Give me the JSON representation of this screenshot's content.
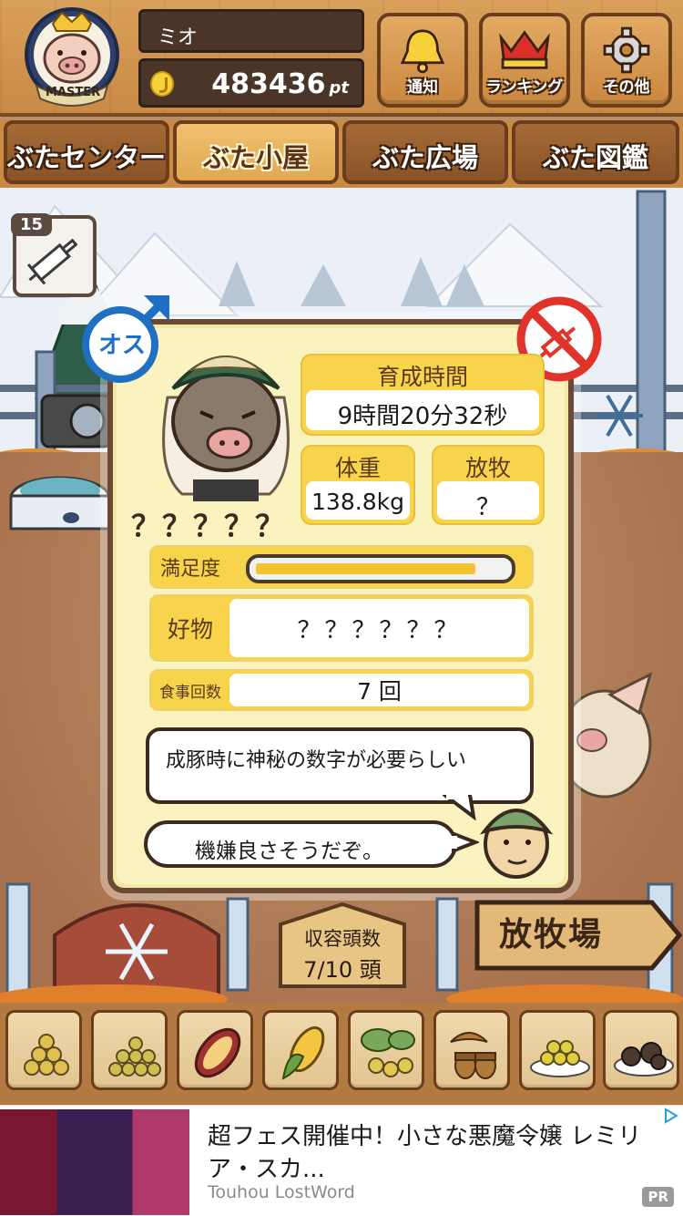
{
  "header": {
    "badge_text": "MASTER",
    "player_name": "ミオ",
    "points": "483436",
    "points_unit": "pt",
    "buttons": [
      {
        "label": "通知",
        "icon": "bell-icon"
      },
      {
        "label": "ランキング",
        "icon": "crown-icon"
      },
      {
        "label": "その他",
        "icon": "gear-icon"
      }
    ]
  },
  "tabs": [
    {
      "label": "ぶたセンター",
      "active": false
    },
    {
      "label": "ぶた小屋",
      "active": true
    },
    {
      "label": "ぶた広場",
      "active": false
    },
    {
      "label": "ぶた図鑑",
      "active": false
    }
  ],
  "vaccine": {
    "count": "15",
    "icon": "syringe-icon"
  },
  "pig": {
    "gender_label": "オス",
    "name": "？？？？？",
    "stats": {
      "growth_label": "育成時間",
      "growth_value": "9時間20分32秒",
      "weight_label": "体重",
      "weight_value": "138.8kg",
      "graze_label": "放牧",
      "graze_value": "？",
      "satisfaction_label": "満足度",
      "satisfaction_level": 0.88,
      "favorite_label": "好物",
      "favorite_value": "？？？？？？",
      "meals_label": "食事回数",
      "meals_value": "7 回"
    }
  },
  "dialogue": {
    "hint": "成豚時に神秘の数字が必要らしい",
    "mood": "機嫌良さそうだぞ。"
  },
  "scene": {
    "sign_label": "放牧場",
    "capacity_label": "収容頭数",
    "capacity_value": "7/10 頭"
  },
  "foods": [
    {
      "icon": "grain-pile-icon"
    },
    {
      "icon": "bean-pile-icon"
    },
    {
      "icon": "sweet-potato-icon"
    },
    {
      "icon": "corn-icon"
    },
    {
      "icon": "leafy-beans-icon"
    },
    {
      "icon": "acorn-icon"
    },
    {
      "icon": "grain-plate-icon"
    },
    {
      "icon": "truffle-plate-icon"
    }
  ],
  "ad": {
    "title": "超フェス開催中！小さな悪魔令嬢 レミリア・スカ...",
    "source": "Touhou LostWord",
    "pr": "PR"
  }
}
